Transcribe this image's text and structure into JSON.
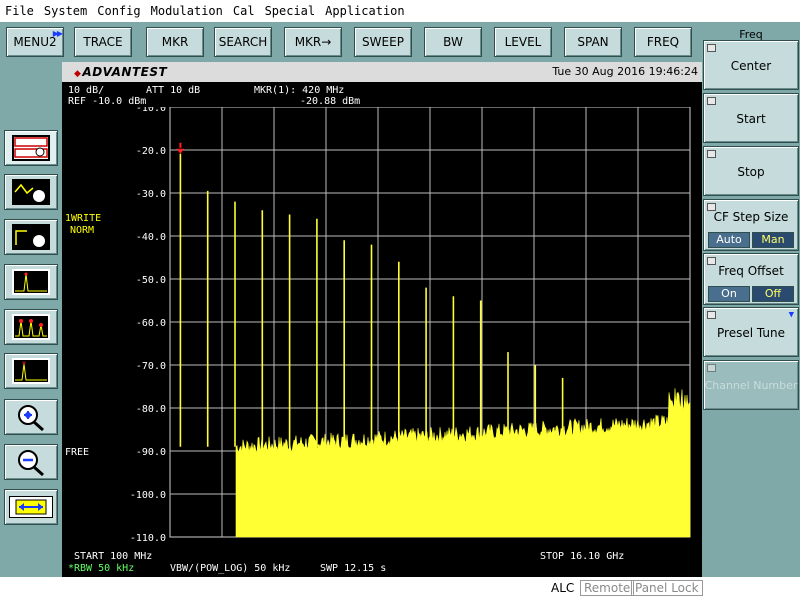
{
  "menu": [
    "File",
    "System",
    "Config",
    "Modulation",
    "Cal",
    "Special",
    "Application"
  ],
  "top_buttons": [
    "MENU2",
    "TRACE",
    "MKR",
    "SEARCH",
    "MKR→",
    "SWEEP",
    "BW",
    "LEVEL",
    "SPAN",
    "FREQ"
  ],
  "left_tools": [
    "trace-view-icon",
    "marker-move-icon",
    "marker-select-icon",
    "peak-search-icon",
    "multi-peak-icon",
    "delta-marker-icon",
    "zoom-in-icon",
    "zoom-out-icon",
    "span-expand-icon"
  ],
  "screen": {
    "logo": "ADVANTEST",
    "datetime": "Tue 30 Aug 2016 19:46:24",
    "scale": "10 dB/",
    "att": "ATT 10 dB",
    "ref": "REF -10.0 dBm",
    "marker_label": "MKR(1): 420 MHz",
    "marker_value": "-20.88 dBm",
    "trace_mode_1": "1WRITE",
    "trace_mode_2": "NORM",
    "free": "FREE",
    "start": "START 100 MHz",
    "stop": "STOP 16.10 GHz",
    "rbw": "*RBW 50 kHz",
    "vbw": "VBW/(POW_LOG) 50 kHz",
    "swp": "SWP 12.15 s"
  },
  "chart_data": {
    "type": "line",
    "x_range_mhz": [
      100,
      16100
    ],
    "ylim": [
      -110,
      -10
    ],
    "yticks": [
      -10.0,
      -20.0,
      -30.0,
      -40.0,
      -50.0,
      -60.0,
      -70.0,
      -80.0,
      -90.0,
      -100.0,
      -110.0
    ],
    "ytick_labels": [
      "-10.0",
      "-20.0",
      "-30.0",
      "-40.0",
      "-50.0",
      "-60.0",
      "-70.0",
      "-80.0",
      "-90.0",
      "-100.0",
      "-110.0"
    ],
    "grid": true,
    "trace_color": "#ffff33",
    "noise_floor_dbm": -89,
    "marker": {
      "x_mhz": 420,
      "y_dbm": -20.88
    },
    "spurs": [
      {
        "x_mhz": 420,
        "y_dbm": -20.88
      },
      {
        "x_mhz": 1260,
        "y_dbm": -29.5
      },
      {
        "x_mhz": 2100,
        "y_dbm": -32
      },
      {
        "x_mhz": 2940,
        "y_dbm": -34
      },
      {
        "x_mhz": 3780,
        "y_dbm": -35
      },
      {
        "x_mhz": 4620,
        "y_dbm": -36
      },
      {
        "x_mhz": 5460,
        "y_dbm": -41
      },
      {
        "x_mhz": 6300,
        "y_dbm": -42
      },
      {
        "x_mhz": 7140,
        "y_dbm": -46
      },
      {
        "x_mhz": 7980,
        "y_dbm": -52
      },
      {
        "x_mhz": 8820,
        "y_dbm": -54
      },
      {
        "x_mhz": 9660,
        "y_dbm": -55
      },
      {
        "x_mhz": 10500,
        "y_dbm": -67
      },
      {
        "x_mhz": 11340,
        "y_dbm": -70
      },
      {
        "x_mhz": 12180,
        "y_dbm": -73
      }
    ]
  },
  "right_panel": {
    "title": "Freq",
    "center": "Center",
    "start": "Start",
    "stop": "Stop",
    "cf_step": "CF Step Size",
    "cf_auto": "Auto",
    "cf_man": "Man",
    "freq_offset": "Freq Offset",
    "fo_on": "On",
    "fo_off": "Off",
    "presel": "Presel Tune",
    "channel": "Channel Number"
  },
  "status": {
    "alc": "ALC",
    "remote": "Remote",
    "panel_lock": "Panel Lock"
  }
}
